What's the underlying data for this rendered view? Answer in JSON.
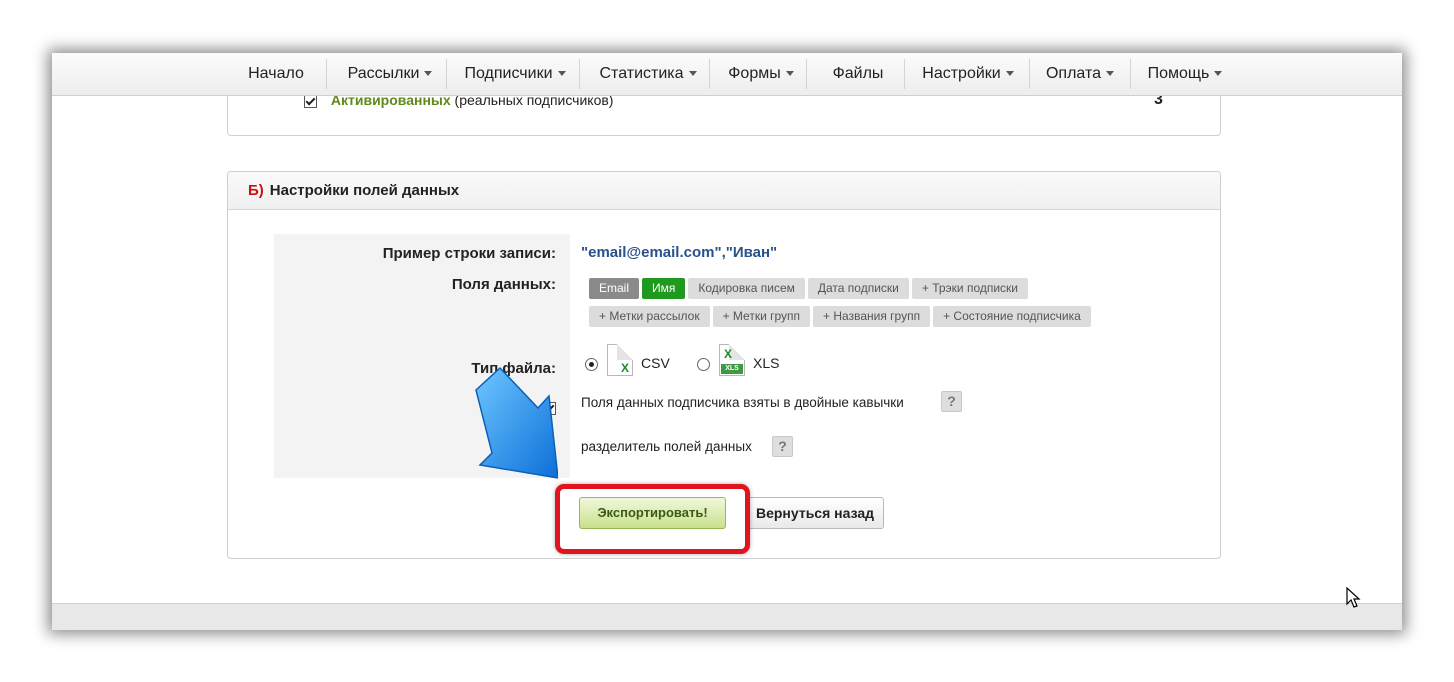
{
  "nav": {
    "items": [
      {
        "label": "Начало",
        "dropdown": false
      },
      {
        "label": "Рассылки",
        "dropdown": true
      },
      {
        "label": "Подписчики",
        "dropdown": true
      },
      {
        "label": "Статистика",
        "dropdown": true
      },
      {
        "label": "Формы",
        "dropdown": true
      },
      {
        "label": "Файлы",
        "dropdown": false
      },
      {
        "label": "Настройки",
        "dropdown": true
      },
      {
        "label": "Оплата",
        "dropdown": true
      },
      {
        "label": "Помощь",
        "dropdown": true
      }
    ]
  },
  "section_a": {
    "activated_checked": true,
    "activated_label": "Активированных",
    "activated_note": "(реальных подписчиков)",
    "activated_count": "3"
  },
  "section_b": {
    "letter": "Б)",
    "title": "Настройки полей данных",
    "example_label": "Пример строки записи:",
    "example_value": "\"email@email.com\",\"Иван\"",
    "fields_label": "Поля данных:",
    "tags_row1": [
      "Email",
      "Имя",
      "Кодировка писем",
      "Дата подписки",
      "+ Трэки подписки"
    ],
    "tags_row2": [
      "+ Метки рассылок",
      "+ Метки групп",
      "+ Названия групп",
      "+ Состояние подписчика"
    ],
    "filetype_label": "Тип файла:",
    "filetype_csv": "CSV",
    "filetype_xls": "XLS",
    "filetype_selected": "CSV",
    "quotes_checked": true,
    "quotes_label": "Поля данных подписчика взяты в двойные кавычки",
    "separator_label": "разделитель полей данных",
    "help_symbol": "?"
  },
  "buttons": {
    "export": "Экспортировать!",
    "back": "Вернуться назад"
  },
  "colors": {
    "highlight": "#e0141c",
    "accent_green": "#1f9a1f",
    "section_letter": "#cc1111",
    "example_text": "#27528a"
  }
}
